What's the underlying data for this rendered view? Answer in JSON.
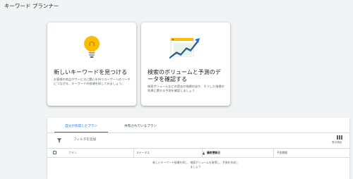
{
  "header": {
    "title": "キーワード プランナー"
  },
  "cards": [
    {
      "title": "新しいキーワードを見つける",
      "description": "お客様の商品やサービスに関心を持つユーザーへのリーチにつながる、キーワードの候補を探してみましょう。",
      "icon": "lightbulb-icon"
    },
    {
      "title": "検索のボリュームと予測のデータを確認する",
      "description": "検索ボリュームなどの過去の指標のほか、そうした指標の効果に関する予測を確認しましょう",
      "icon": "growth-chart-icon"
    }
  ],
  "plans": {
    "tabs": [
      "自分が作成したプラン",
      "共有されているプラン"
    ],
    "filter_label": "フィルタを追加",
    "columns_label": "表示項目",
    "table_headers": [
      "プラン",
      "ステータス",
      "最終更新日",
      "予測期間"
    ],
    "empty_message_line1": "新しいキーワード候補を探し、検索ボリュームを取得し、予測を作成し",
    "empty_message_line2": "ましょう"
  },
  "colors": {
    "accent": "#1a73e8",
    "bulb": "#fbbc04",
    "background": "#f1f3f4"
  }
}
